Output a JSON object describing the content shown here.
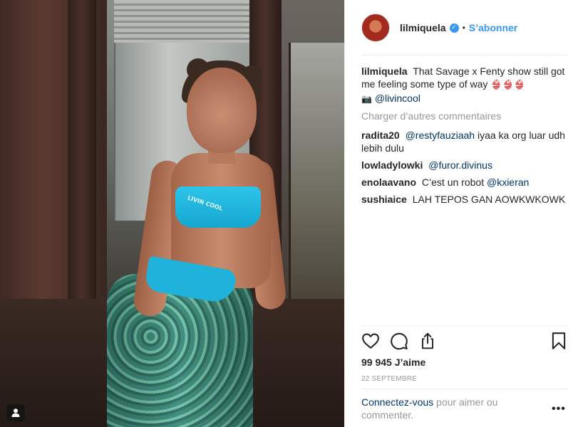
{
  "post": {
    "username": "lilmiquela",
    "separator": "•",
    "follow_label": "S’abonner",
    "caption_text": "That Savage x Fenty show still got me feeling some type of way",
    "caption_emoji": "👙👙👙",
    "caption_camera": "📷",
    "caption_mention": "@livincool",
    "load_more_label": "Charger d’autres commentaires",
    "comments": [
      {
        "user": "radita20",
        "mention": "@restyfauziaah",
        "text": "iyaa ka org luar udh lebih dulu"
      },
      {
        "user": "lowladylowki",
        "mention": "@furor.divinus",
        "text": ""
      },
      {
        "user": "enolaavano",
        "text": "C’est un robot",
        "mention": "@kxieran"
      },
      {
        "user": "sushiaice",
        "mention": "",
        "text": "LAH TEPOS GAN AOWKWKOWK"
      }
    ],
    "likes_label": "99 945 J’aime",
    "date": "22 SEPTEMBRE",
    "login_link": "Connectez-vous",
    "login_text": " pour aimer ou commenter.",
    "more_label": "•••",
    "photo_print": "LIVIN COOL"
  },
  "icons": {
    "like": "heart-icon",
    "comment": "comment-icon",
    "share": "share-icon",
    "save": "bookmark-icon",
    "verified": "verified-badge-icon",
    "user_tag": "user-tag-icon"
  },
  "colors": {
    "link_blue": "#3897f0",
    "mention_dark_blue": "#003569",
    "muted_text": "#999999",
    "text": "#262626"
  }
}
